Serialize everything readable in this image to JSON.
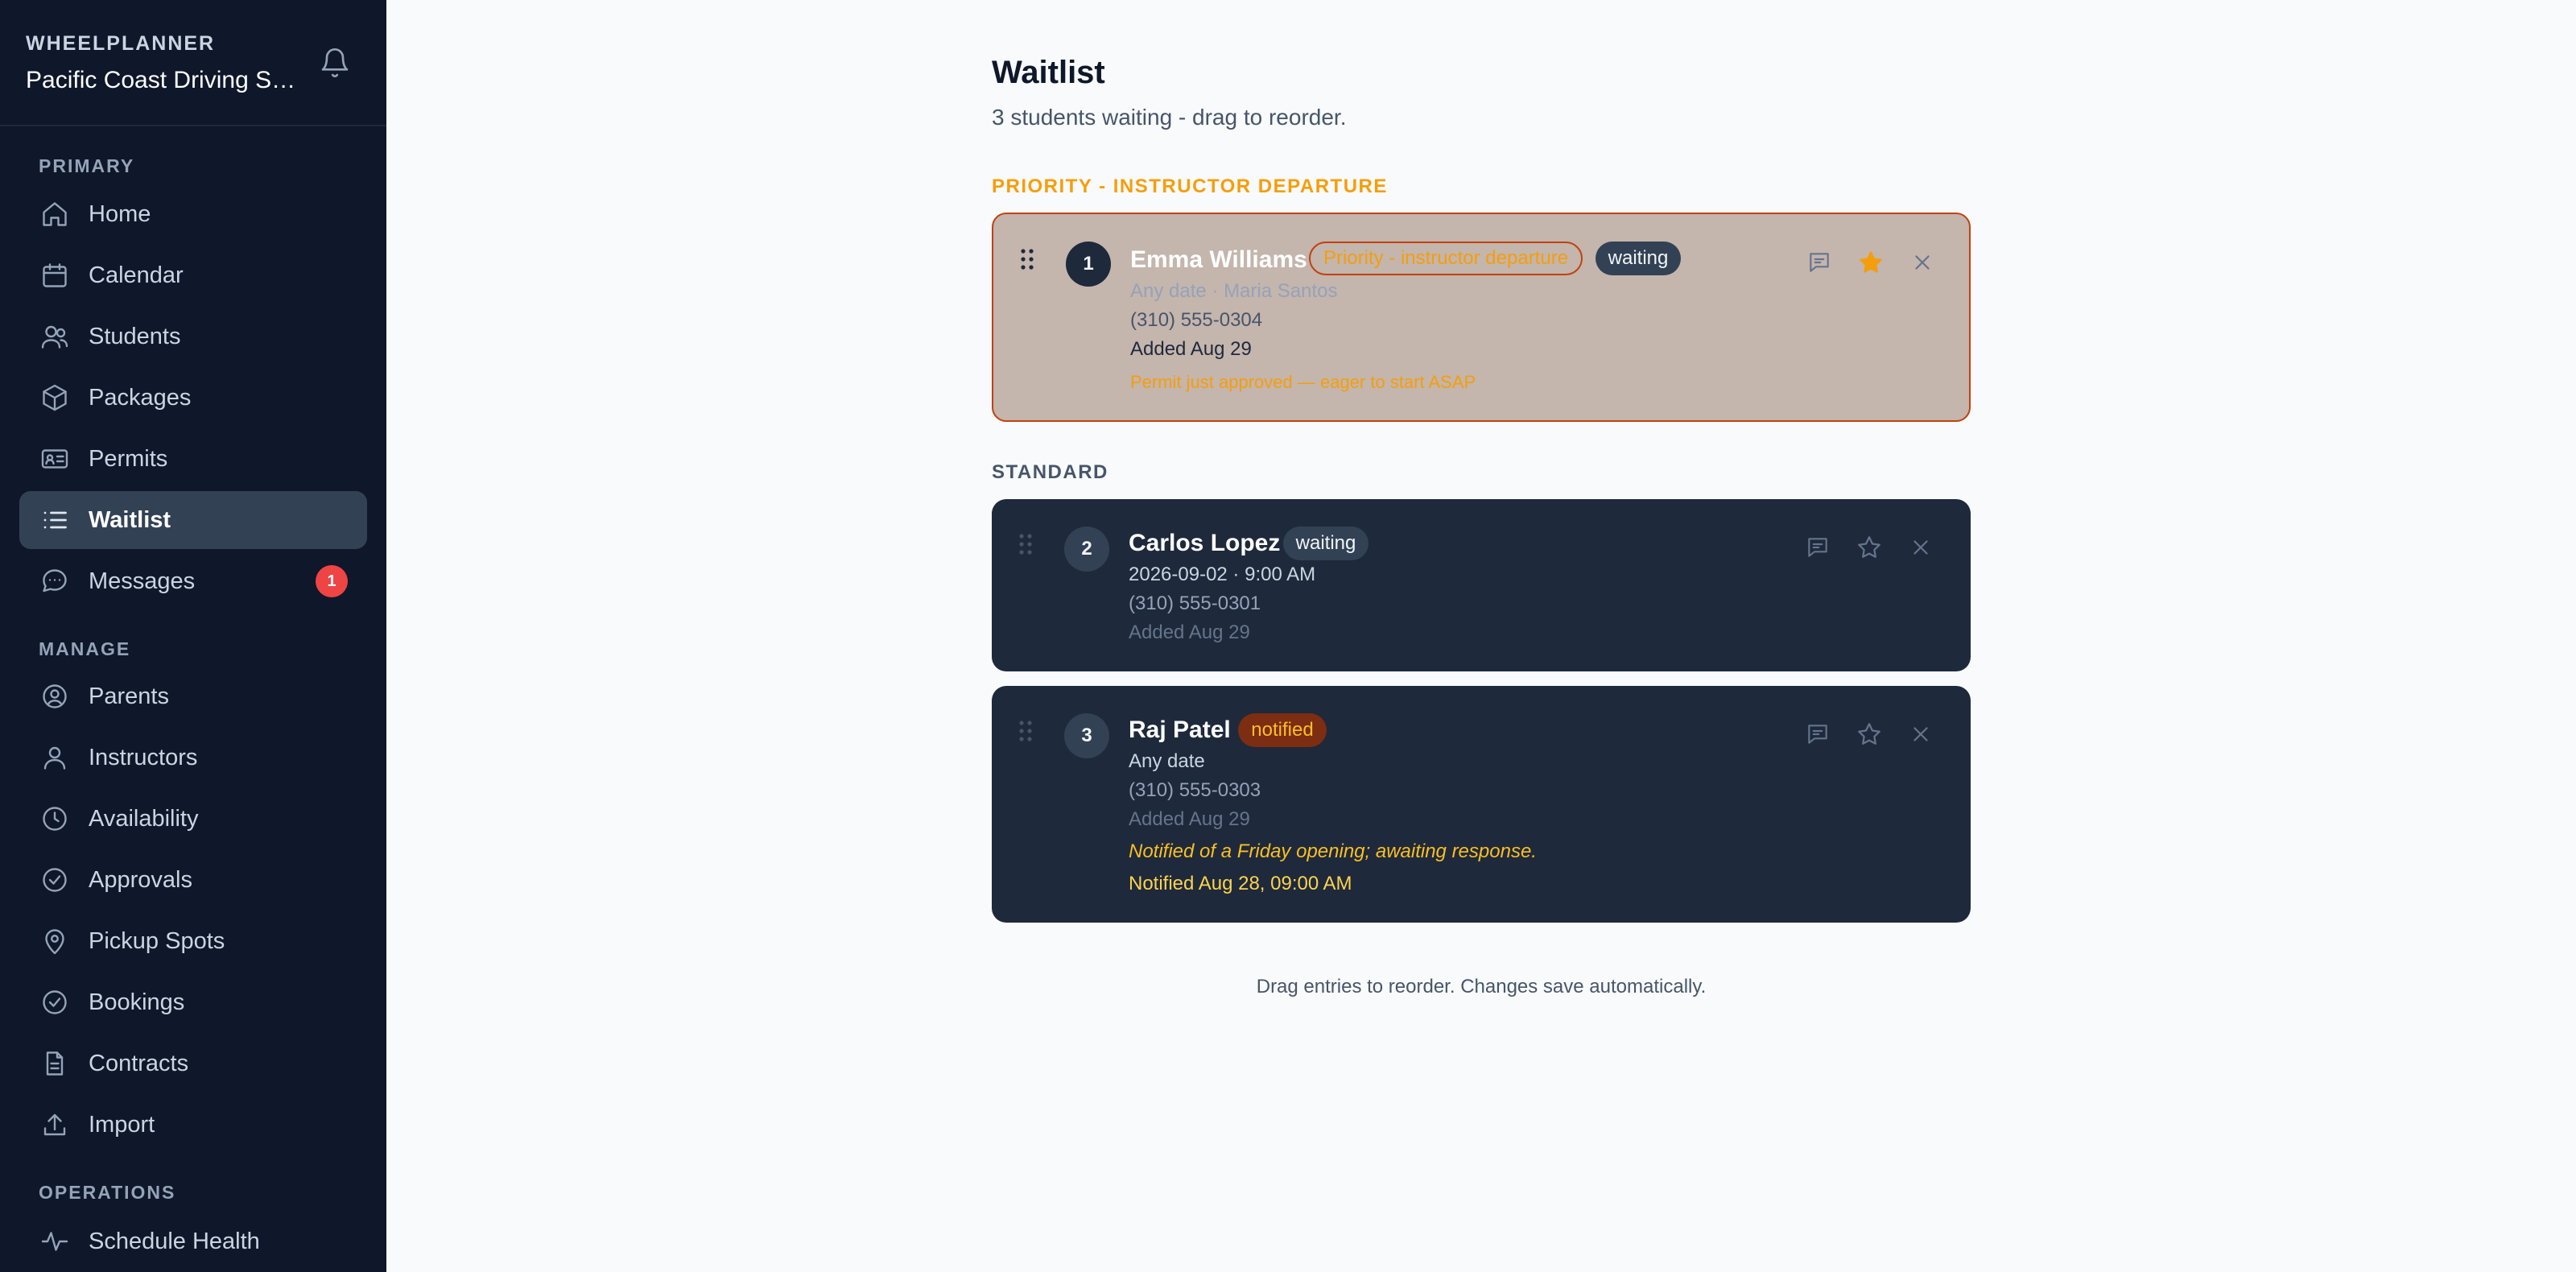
{
  "sidebar": {
    "brand": "WHEELPLANNER",
    "org": "Pacific Coast Driving Sc...",
    "sections": {
      "primary": "PRIMARY",
      "manage": "MANAGE",
      "operations": "OPERATIONS"
    },
    "items": [
      {
        "label": "Home",
        "icon": "home-icon"
      },
      {
        "label": "Calendar",
        "icon": "calendar-icon"
      },
      {
        "label": "Students",
        "icon": "users-icon"
      },
      {
        "label": "Packages",
        "icon": "box-icon"
      },
      {
        "label": "Permits",
        "icon": "id-card-icon"
      },
      {
        "label": "Waitlist",
        "icon": "list-icon",
        "active": true
      },
      {
        "label": "Messages",
        "icon": "chat-icon",
        "badge": "1"
      },
      {
        "label": "Parents",
        "icon": "user-circle-icon"
      },
      {
        "label": "Instructors",
        "icon": "user-icon"
      },
      {
        "label": "Availability",
        "icon": "clock-icon"
      },
      {
        "label": "Approvals",
        "icon": "check-circle-icon"
      },
      {
        "label": "Pickup Spots",
        "icon": "map-pin-icon"
      },
      {
        "label": "Bookings",
        "icon": "check-circle-icon"
      },
      {
        "label": "Contracts",
        "icon": "document-icon"
      },
      {
        "label": "Import",
        "icon": "upload-icon"
      },
      {
        "label": "Schedule Health",
        "icon": "activity-icon"
      }
    ]
  },
  "main": {
    "title": "Waitlist",
    "subtitle": "3 students waiting - drag to reorder.",
    "priority_label": "PRIORITY - INSTRUCTOR DEPARTURE",
    "standard_label": "STANDARD",
    "footer": "Drag entries to reorder. Changes save automatically.",
    "entries": [
      {
        "position": "1",
        "name": "Emma Williams",
        "priority_tag": "Priority - instructor departure",
        "status": "waiting",
        "when": "Any date · Maria Santos",
        "phone": "(310) 555-0304",
        "added": "Added Aug 29",
        "note": "Permit just approved — eager to start ASAP",
        "starred": true
      },
      {
        "position": "2",
        "name": "Carlos Lopez",
        "status": "waiting",
        "when": "2026-09-02 · 9:00 AM",
        "phone": "(310) 555-0301",
        "added": "Added Aug 29",
        "starred": false
      },
      {
        "position": "3",
        "name": "Raj Patel",
        "status": "notified",
        "when": "Any date",
        "phone": "(310) 555-0303",
        "added": "Added Aug 29",
        "note": "Notified of a Friday opening; awaiting response.",
        "notified_at": "Notified Aug 28, 09:00 AM",
        "starred": false
      }
    ]
  },
  "colors": {
    "sidebar_bg": "#0f172a",
    "active_nav": "#334155",
    "accent_amber": "#f59e0b",
    "card_dark": "#1e293b",
    "priority_border": "#c2410c",
    "badge_red": "#ef4444"
  }
}
